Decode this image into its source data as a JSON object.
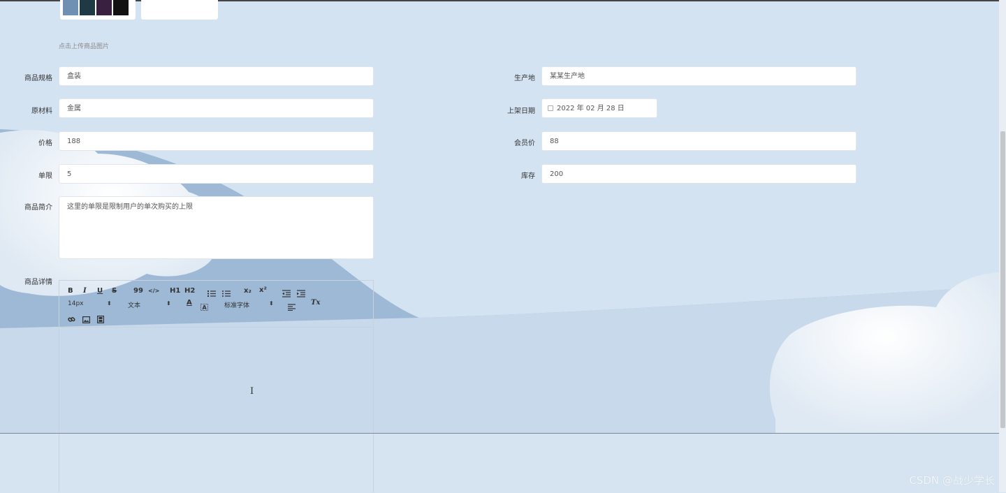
{
  "upload": {
    "hint": "点击上传商品图片"
  },
  "form": {
    "spec": {
      "label": "商品规格",
      "value": "盒装"
    },
    "origin": {
      "label": "生产地",
      "value": "某某生产地"
    },
    "material": {
      "label": "原材料",
      "value": "金属"
    },
    "shelf_date": {
      "label": "上架日期",
      "value": "2022 年 02 月 28 日"
    },
    "price": {
      "label": "价格",
      "value": "188"
    },
    "member_price": {
      "label": "会员价",
      "value": "88"
    },
    "limit": {
      "label": "单限",
      "value": "5"
    },
    "stock": {
      "label": "库存",
      "value": "200"
    },
    "intro": {
      "label": "商品简介",
      "value": "这里的单限是限制用户的单次购买的上限"
    },
    "detail": {
      "label": "商品详情"
    }
  },
  "editor": {
    "toolbar": {
      "bold": "B",
      "italic": "I",
      "underline": "U",
      "strike": "S",
      "quote": "99",
      "code": "</>",
      "h1": "H1",
      "h2": "H2",
      "sub": "x₂",
      "sup": "x²",
      "font_size": "14px",
      "block_type": "文本",
      "font_family": "标准字体",
      "text_color": "A",
      "clear": "Tx"
    }
  },
  "watermark": "CSDN @战少学长",
  "colors": {
    "background": "#d4e3f2",
    "mountain": "#9db9d6",
    "cloud": "#ffffff"
  }
}
